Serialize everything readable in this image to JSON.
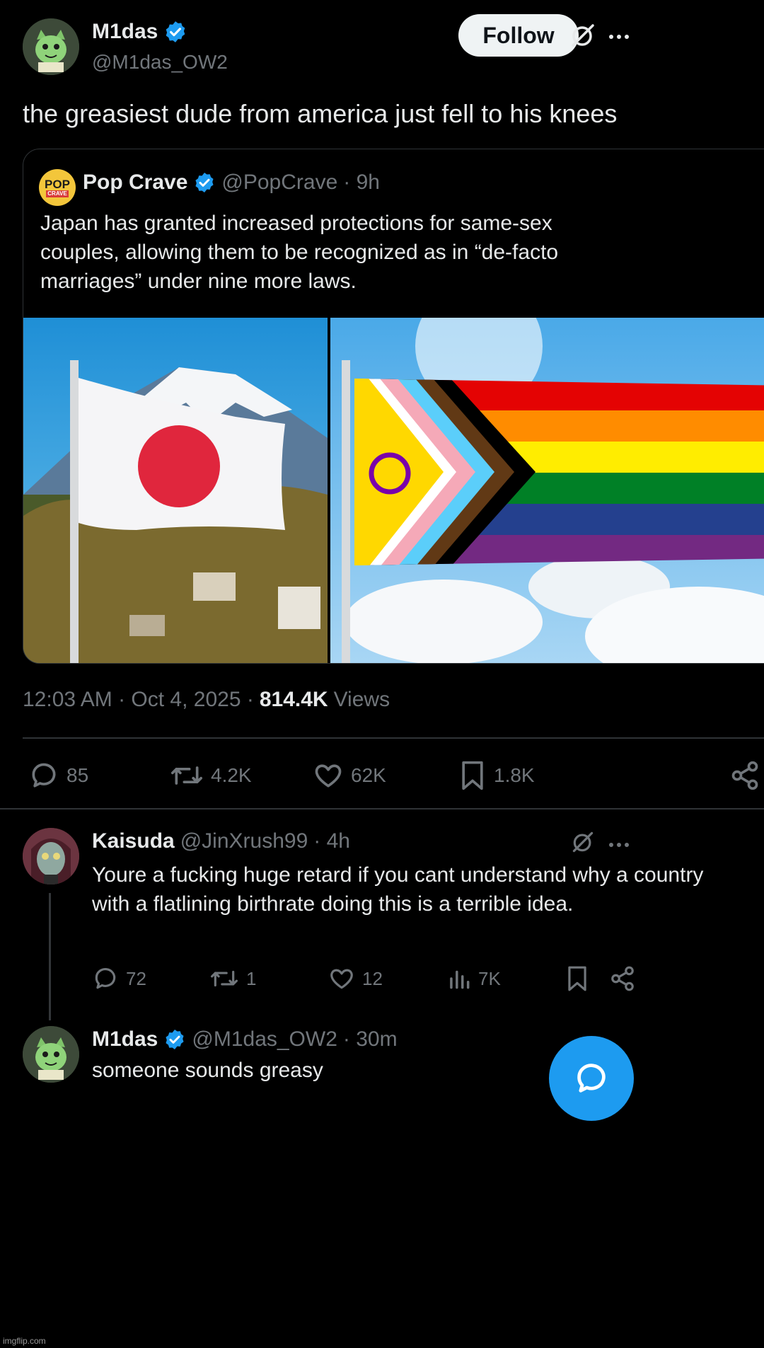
{
  "main_tweet": {
    "author_name": "M1das",
    "author_handle": "@M1das_OW2",
    "follow_label": "Follow",
    "text": "the greasiest dude from america just fell to his knees",
    "quoted": {
      "author_name": "Pop Crave",
      "author_handle": "@PopCrave",
      "time": "· 9h",
      "logo_text": "POP",
      "logo_subtext": "CRAVE",
      "text": "Japan has granted increased protections for same-sex couples, allowing them to be recognized as in “de-facto marriages” under nine more laws."
    },
    "timestamp": "12:03 AM · Oct 4, 2025 ·",
    "views_count": "814.4K",
    "views_label": "Views",
    "actions": {
      "replies": "85",
      "reposts": "4.2K",
      "likes": "62K",
      "bookmarks": "1.8K"
    }
  },
  "replies": [
    {
      "author_name": "Kaisuda",
      "author_handle": "@JinXrush99",
      "time": "· 4h",
      "text": "Youre a fucking huge retard if you cant understand why a country with a flatlining birthrate doing this is a terrible idea.",
      "actions": {
        "replies": "72",
        "reposts": "1",
        "likes": "12",
        "views": "7K"
      }
    },
    {
      "author_name": "M1das",
      "author_handle": "@M1das_OW2",
      "time": "· 30m",
      "text": "someone sounds greasy"
    }
  ],
  "watermark": "imgflip.com",
  "colors": {
    "accent": "#1d9bf0",
    "background": "#000000",
    "text": "#e7e9ea",
    "muted": "#71767b"
  }
}
